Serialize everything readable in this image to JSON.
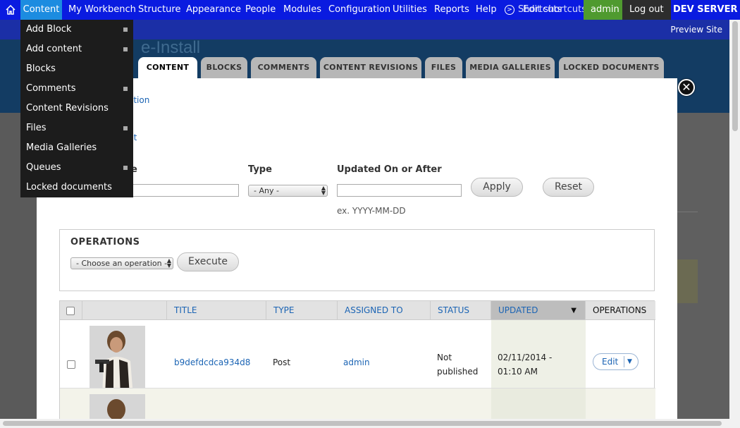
{
  "toolbar": {
    "items": [
      "Content",
      "My Workbench",
      "Structure",
      "Appearance",
      "People",
      "Modules",
      "Configuration",
      "Utilities",
      "Reports",
      "Help"
    ],
    "shortcuts_label": "Shortcuts",
    "edit_shortcuts_label": "Edit shortcuts",
    "user": "admin",
    "logout": "Log out",
    "server": "DEV SERVER",
    "preview_site": "Preview Site"
  },
  "background": {
    "page_title_fragment": "e-Install",
    "link_fragment_1": "ation",
    "link_fragment_2": "nt",
    "label_fragment": "e"
  },
  "tabs": [
    "CONTENT",
    "BLOCKS",
    "COMMENTS",
    "CONTENT REVISIONS",
    "FILES",
    "MEDIA GALLERIES",
    "LOCKED DOCUMENTS"
  ],
  "active_tab": "CONTENT",
  "filters": {
    "type_label": "Type",
    "type_value": "- Any -",
    "updated_label": "Updated On or After",
    "updated_value": "",
    "updated_hint": "ex. YYYY-MM-DD",
    "apply_label": "Apply",
    "reset_label": "Reset"
  },
  "operations": {
    "title": "OPERATIONS",
    "select_value": "- Choose an operation -",
    "execute_label": "Execute"
  },
  "table": {
    "headers": [
      "TITLE",
      "TYPE",
      "ASSIGNED TO",
      "STATUS",
      "UPDATED",
      "OPERATIONS"
    ],
    "sorted_column": "UPDATED",
    "rows": [
      {
        "title": "b9defdcdca934d8",
        "type": "Post",
        "assigned_to": "admin",
        "status": "Not published",
        "updated": "02/11/2014 - 01:10 AM",
        "edit_label": "Edit"
      }
    ]
  },
  "flyout_menu": {
    "items": [
      {
        "label": "Add Block",
        "has_submenu": true
      },
      {
        "label": "Add content",
        "has_submenu": true
      },
      {
        "label": "Blocks",
        "has_submenu": false
      },
      {
        "label": "Comments",
        "has_submenu": true
      },
      {
        "label": "Content Revisions",
        "has_submenu": false
      },
      {
        "label": "Files",
        "has_submenu": true
      },
      {
        "label": "Media Galleries",
        "has_submenu": false
      },
      {
        "label": "Queues",
        "has_submenu": true
      },
      {
        "label": "Locked documents",
        "has_submenu": false
      }
    ]
  },
  "colors": {
    "toolbar": "#0a1be0",
    "active_toolbar_item": "#1c8ce0",
    "admin_badge": "#4f9a2f",
    "link": "#1b64b4"
  }
}
